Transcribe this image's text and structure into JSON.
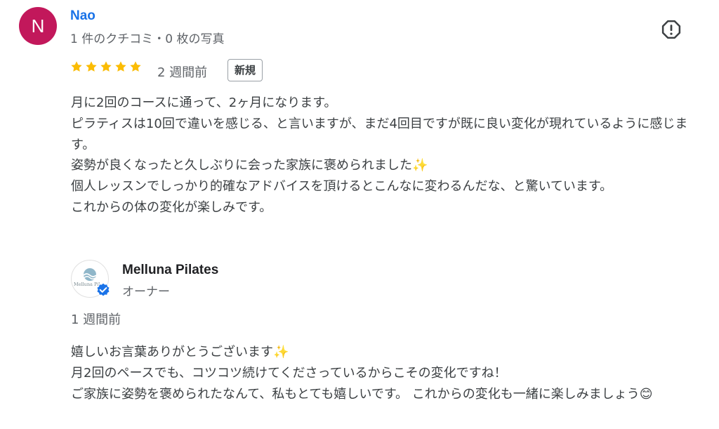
{
  "review": {
    "avatar_letter": "N",
    "avatar_color": "#c2185b",
    "reviewer_name": "Nao",
    "reviewer_meta": "1 件のクチコミ・0 枚の写真",
    "rating": 5,
    "star_color": "#fbbc04",
    "date": "2 週間前",
    "badge": "新規",
    "text": "月に2回のコースに通って、2ヶ月になります。\nピラティスは10回で違いを感じる、と言いますが、まだ4回目ですが既に良い変化が現れているように感じます。\n姿勢が良くなったと久しぶりに会った家族に褒められました✨\n個人レッスンでしっかり的確なアドバイスを頂けるとこんなに変わるんだな、と驚いています。\nこれからの体の変化が楽しみです。",
    "report_icon": "report-flag-icon"
  },
  "owner_reply": {
    "logo_text": "Melluna Pil",
    "owner_name": "Melluna Pilates",
    "owner_role": "オーナー",
    "verified_color": "#1a73e8",
    "date": "1 週間前",
    "text": "嬉しいお言葉ありがとうございます✨\n月2回のペースでも、コツコツ続けてくださっているからこその変化ですね！\nご家族に姿勢を褒められたなんて、私もとても嬉しいです。 これからの変化も一緒に楽しみましょう😊"
  }
}
